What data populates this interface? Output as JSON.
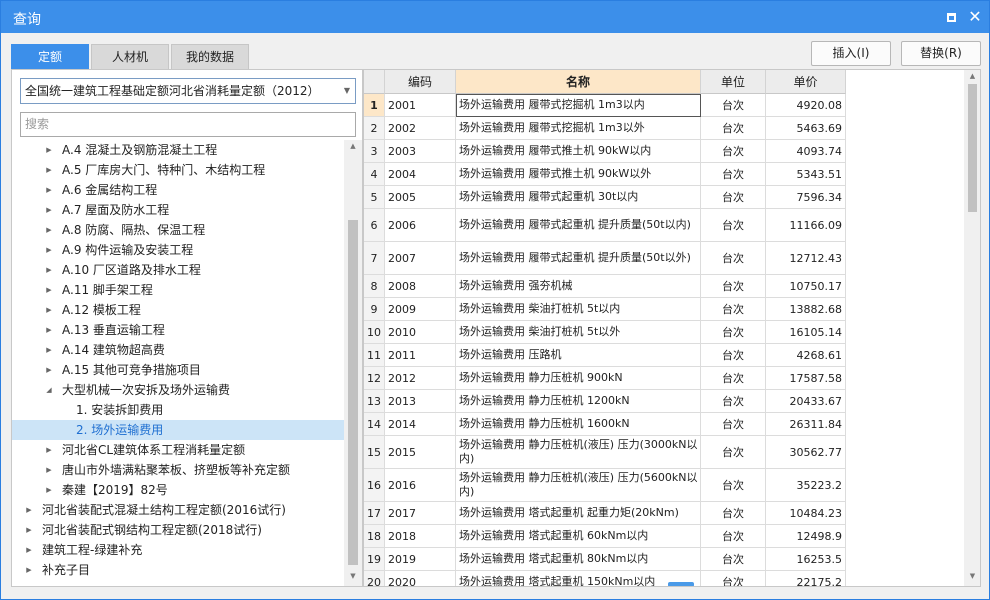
{
  "window": {
    "title": "查询"
  },
  "tabs": [
    {
      "label": "定额"
    },
    {
      "label": "人材机"
    },
    {
      "label": "我的数据"
    }
  ],
  "buttons": {
    "insert": "插入(I)",
    "replace": "替换(R)"
  },
  "library_select": {
    "value": "全国统一建筑工程基础定额河北省消耗量定额（2012）"
  },
  "search": {
    "placeholder": "搜索"
  },
  "tree": [
    {
      "label": "A.4 混凝土及钢筋混凝土工程",
      "level": 2,
      "state": "collapsed"
    },
    {
      "label": "A.5 厂库房大门、特种门、木结构工程",
      "level": 2,
      "state": "collapsed"
    },
    {
      "label": "A.6 金属结构工程",
      "level": 2,
      "state": "collapsed"
    },
    {
      "label": "A.7 屋面及防水工程",
      "level": 2,
      "state": "collapsed"
    },
    {
      "label": "A.8 防腐、隔热、保温工程",
      "level": 2,
      "state": "collapsed"
    },
    {
      "label": "A.9 构件运输及安装工程",
      "level": 2,
      "state": "collapsed"
    },
    {
      "label": "A.10 厂区道路及排水工程",
      "level": 2,
      "state": "collapsed"
    },
    {
      "label": "A.11 脚手架工程",
      "level": 2,
      "state": "collapsed"
    },
    {
      "label": "A.12 模板工程",
      "level": 2,
      "state": "collapsed"
    },
    {
      "label": "A.13 垂直运输工程",
      "level": 2,
      "state": "collapsed"
    },
    {
      "label": "A.14 建筑物超高费",
      "level": 2,
      "state": "collapsed"
    },
    {
      "label": "A.15 其他可竞争措施项目",
      "level": 2,
      "state": "collapsed"
    },
    {
      "label": "大型机械一次安拆及场外运输费",
      "level": 2,
      "state": "expanded"
    },
    {
      "label": "1. 安装拆卸费用",
      "level": 3,
      "state": "leaf"
    },
    {
      "label": "2. 场外运输费用",
      "level": 3,
      "state": "leaf",
      "selected": true
    },
    {
      "label": "河北省CL建筑体系工程消耗量定额",
      "level": 2,
      "state": "collapsed"
    },
    {
      "label": "唐山市外墙满粘聚苯板、挤塑板等补充定额",
      "level": 2,
      "state": "collapsed"
    },
    {
      "label": "秦建【2019】82号",
      "level": 2,
      "state": "collapsed"
    },
    {
      "label": "河北省装配式混凝土结构工程定额(2016试行)",
      "level": 1,
      "state": "collapsed"
    },
    {
      "label": "河北省装配式钢结构工程定额(2018试行)",
      "level": 1,
      "state": "collapsed"
    },
    {
      "label": "建筑工程-绿建补充",
      "level": 1,
      "state": "collapsed"
    },
    {
      "label": "补充子目",
      "level": 1,
      "state": "collapsed"
    }
  ],
  "table": {
    "columns": {
      "code": "编码",
      "name": "名称",
      "unit": "单位",
      "price": "单价"
    },
    "rows": [
      {
        "idx": "1",
        "code": "2001",
        "name": "场外运输费用 履带式挖掘机 1m3以内",
        "unit": "台次",
        "price": "4920.08"
      },
      {
        "idx": "2",
        "code": "2002",
        "name": "场外运输费用 履带式挖掘机 1m3以外",
        "unit": "台次",
        "price": "5463.69"
      },
      {
        "idx": "3",
        "code": "2003",
        "name": "场外运输费用 履带式推土机 90kW以内",
        "unit": "台次",
        "price": "4093.74"
      },
      {
        "idx": "4",
        "code": "2004",
        "name": "场外运输费用 履带式推土机 90kW以外",
        "unit": "台次",
        "price": "5343.51"
      },
      {
        "idx": "5",
        "code": "2005",
        "name": "场外运输费用 履带式起重机 30t以内",
        "unit": "台次",
        "price": "7596.34"
      },
      {
        "idx": "6",
        "code": "2006",
        "name": "场外运输费用 履带式起重机 提升质量(50t以内)",
        "unit": "台次",
        "price": "11166.09"
      },
      {
        "idx": "7",
        "code": "2007",
        "name": "场外运输费用 履带式起重机 提升质量(50t以外)",
        "unit": "台次",
        "price": "12712.43"
      },
      {
        "idx": "8",
        "code": "2008",
        "name": "场外运输费用 强夯机械",
        "unit": "台次",
        "price": "10750.17"
      },
      {
        "idx": "9",
        "code": "2009",
        "name": "场外运输费用 柴油打桩机 5t以内",
        "unit": "台次",
        "price": "13882.68"
      },
      {
        "idx": "10",
        "code": "2010",
        "name": "场外运输费用 柴油打桩机 5t以外",
        "unit": "台次",
        "price": "16105.14"
      },
      {
        "idx": "11",
        "code": "2011",
        "name": "场外运输费用 压路机",
        "unit": "台次",
        "price": "4268.61"
      },
      {
        "idx": "12",
        "code": "2012",
        "name": "场外运输费用 静力压桩机 900kN",
        "unit": "台次",
        "price": "17587.58"
      },
      {
        "idx": "13",
        "code": "2013",
        "name": "场外运输费用 静力压桩机 1200kN",
        "unit": "台次",
        "price": "20433.67"
      },
      {
        "idx": "14",
        "code": "2014",
        "name": "场外运输费用 静力压桩机 1600kN",
        "unit": "台次",
        "price": "26311.84"
      },
      {
        "idx": "15",
        "code": "2015",
        "name": "场外运输费用 静力压桩机(液压) 压力(3000kN以内)",
        "unit": "台次",
        "price": "30562.77"
      },
      {
        "idx": "16",
        "code": "2016",
        "name": "场外运输费用 静力压桩机(液压) 压力(5600kN以内)",
        "unit": "台次",
        "price": "35223.2"
      },
      {
        "idx": "17",
        "code": "2017",
        "name": "场外运输费用 塔式起重机 起重力矩(20kNm)",
        "unit": "台次",
        "price": "10484.23"
      },
      {
        "idx": "18",
        "code": "2018",
        "name": "场外运输费用 塔式起重机 60kNm以内",
        "unit": "台次",
        "price": "12498.9"
      },
      {
        "idx": "19",
        "code": "2019",
        "name": "场外运输费用 塔式起重机 80kNm以内",
        "unit": "台次",
        "price": "16253.5"
      },
      {
        "idx": "20",
        "code": "2020",
        "name": "场外运输费用 塔式起重机 150kNm以内",
        "unit": "台次",
        "price": "22175.2"
      }
    ]
  }
}
